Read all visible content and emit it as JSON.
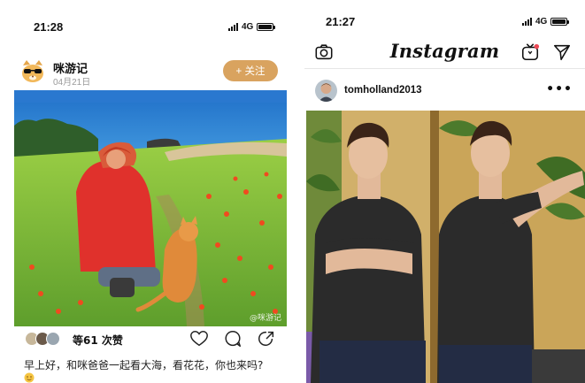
{
  "left_phone": {
    "status": {
      "time": "21:28",
      "network": "4G"
    },
    "post": {
      "username": "咪游记",
      "date": "04月21日",
      "follow_label": "+ 关注",
      "watermark": "@咪游记",
      "likes_text": "等61 次赞",
      "caption": "早上好，和咪爸爸一起看大海，看花花，你也来吗?",
      "icons": [
        "cat-sunglasses-icon",
        "heart-icon",
        "comment-icon",
        "share-icon",
        "smile-emoji-icon"
      ]
    }
  },
  "right_phone": {
    "status": {
      "time": "21:27",
      "network": "4G"
    },
    "topbar": {
      "logo": "Instagram",
      "icons": [
        "camera-icon",
        "igtv-icon",
        "direct-message-icon"
      ],
      "notification_color": "#ed4956"
    },
    "post": {
      "username": "tomholland2013",
      "more_label": "•••"
    }
  },
  "colors": {
    "follow_button": "#d9a35f",
    "text_primary": "#111111",
    "text_secondary": "#9a9a9a"
  }
}
